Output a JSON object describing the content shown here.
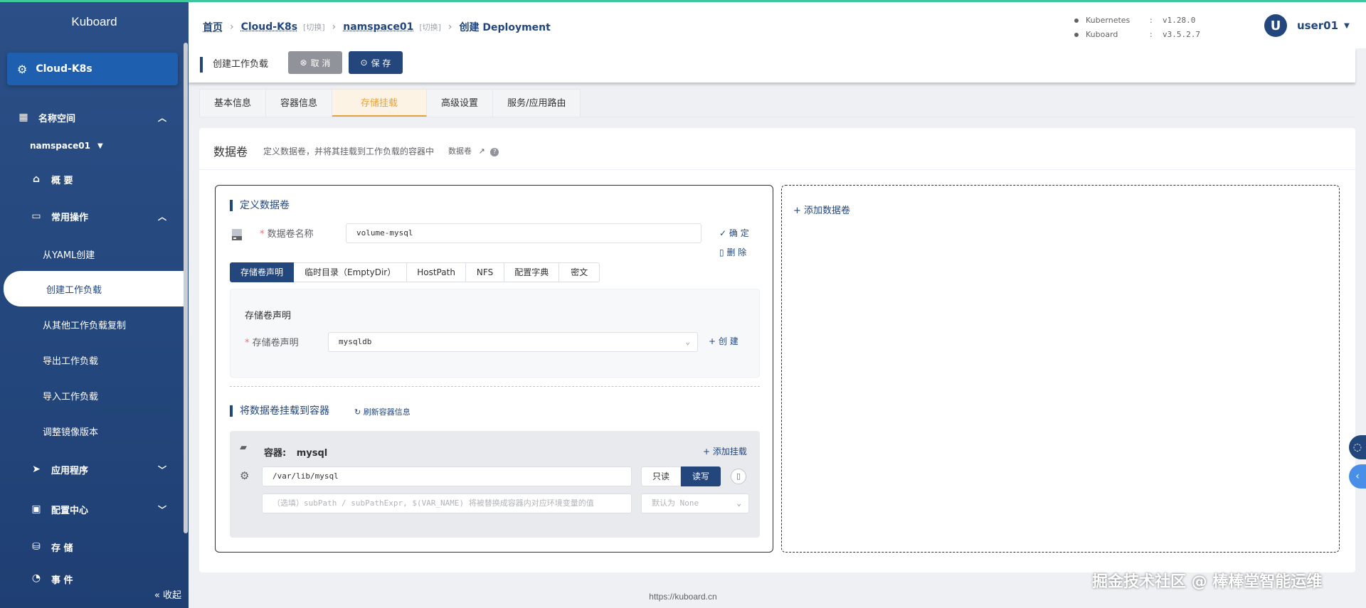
{
  "brand": "Kuboard",
  "cluster": "Cloud-K8s",
  "sidebar": {
    "namespace_section": "名称空间",
    "namespace": "namspace01",
    "overview": "概 要",
    "common_ops": "常用操作",
    "items": [
      "从YAML创建",
      "创建工作负载",
      "从其他工作负载复制",
      "导出工作负载",
      "导入工作负载",
      "调整镜像版本"
    ],
    "apps": "应用程序",
    "config": "配置中心",
    "storage": "存 储",
    "events": "事 件",
    "collapse": "收起"
  },
  "header": {
    "crumbs": [
      "首页",
      "Cloud-K8s",
      "namspace01",
      "创建 Deployment"
    ],
    "switch": "[切换]",
    "versions": [
      {
        "name": "Kubernetes",
        "value": "v1.28.0"
      },
      {
        "name": "Kuboard",
        "value": "v3.5.2.7"
      }
    ],
    "colon": ":",
    "avatar": "U",
    "user": "user01"
  },
  "actionbar": {
    "title": "创建工作负载",
    "cancel": "取 消",
    "save": "保 存"
  },
  "tabs": [
    "基本信息",
    "容器信息",
    "存储挂载",
    "高级设置",
    "服务/应用路由"
  ],
  "active_tab": "存储挂载",
  "volumes": {
    "title": "数据卷",
    "desc": "定义数据卷，并将其挂载到工作负载的容器中",
    "link": "数据卷",
    "define_title": "定义数据卷",
    "name_label": "数据卷名称",
    "name_value": "volume-mysql",
    "confirm": "确 定",
    "delete": "删 除",
    "types": [
      "存储卷声明",
      "临时目录（EmptyDir）",
      "HostPath",
      "NFS",
      "配置字典",
      "密文"
    ],
    "active_type": "存储卷声明",
    "pvc_panel_title": "存储卷声明",
    "pvc_label": "存储卷声明",
    "pvc_value": "mysqldb",
    "create": "创 建",
    "mount_title": "将数据卷挂载到容器",
    "refresh": "刷新容器信息",
    "container_label": "容器:",
    "container_name": "mysql",
    "add_mount": "添加挂载",
    "mount_path": "/var/lib/mysql",
    "readonly": "只读",
    "readwrite": "读写",
    "subpath_placeholder": "（选填）subPath / subPathExpr, $(VAR_NAME) 将被替换成容器内对应环境变量的值",
    "propagation_placeholder": "默认为 None",
    "add_volume": "添加数据卷"
  },
  "footer": "https://kuboard.cn",
  "watermark": "掘金技术社区 @ 棒棒堂智能运维",
  "colors": {
    "primary": "#23467c",
    "accent": "#e6a23c",
    "sidebar": "#2b4f86",
    "green": "#3fc79d"
  }
}
